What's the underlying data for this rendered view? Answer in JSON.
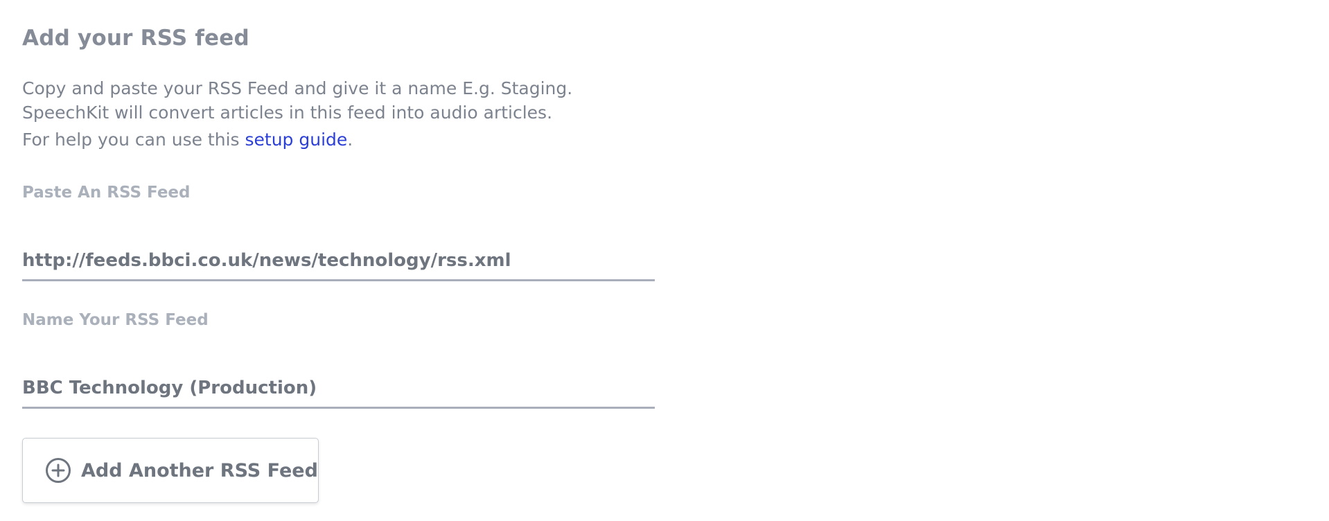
{
  "form": {
    "title": "Add your RSS feed",
    "description_line1": "Copy and paste your RSS Feed and give it a name E.g. Staging.",
    "description_line2": "SpeechKit will convert articles in this feed into audio articles.",
    "help_prefix": "For help you can use this ",
    "help_link": "setup guide",
    "help_suffix": ".",
    "feed_label": "Paste An RSS Feed",
    "feed_value": "http://feeds.bbci.co.uk/news/technology/rss.xml",
    "name_label": "Name Your RSS Feed",
    "name_value": "BBC Technology (Production)",
    "add_button_label": "Add Another RSS Feed",
    "add_button_icon": "plus-circle-icon"
  },
  "colors": {
    "heading": "#858c97",
    "text": "#7c838e",
    "link": "#2c3fd6",
    "label": "#aab1bb",
    "input_text": "#6e757f",
    "underline": "#a9afba",
    "button_border": "#c8ccd3"
  }
}
